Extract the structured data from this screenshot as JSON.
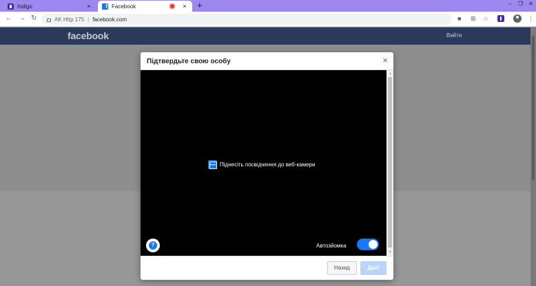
{
  "browser": {
    "tabs": [
      {
        "label": "Indigo",
        "active": false,
        "icon": "indigo-icon"
      },
      {
        "label": "Facebook",
        "active": true,
        "icon": "facebook-icon",
        "recording": true
      }
    ],
    "new_tab_symbol": "+",
    "close_symbol": "×",
    "address_bar": {
      "profile": "AK Http 175",
      "separator": "|",
      "url": "facebook.com"
    }
  },
  "page": {
    "logo": "facebook",
    "login_link": "Вийти"
  },
  "modal": {
    "title": "Підтвердьте свою особу",
    "close_symbol": "×",
    "video": {
      "hint": "Піднесіть посвідчення до веб-камери",
      "help_symbol": "?",
      "auto_capture_label": "Автозйомка",
      "auto_capture_on": true
    },
    "buttons": {
      "back": "Назад",
      "next": "Далі"
    }
  },
  "colors": {
    "accent": "#1877f2",
    "tabstrip": "#9f87f0",
    "fb_header": "#2b3a5c",
    "next_disabled": "#b9d5fb"
  }
}
